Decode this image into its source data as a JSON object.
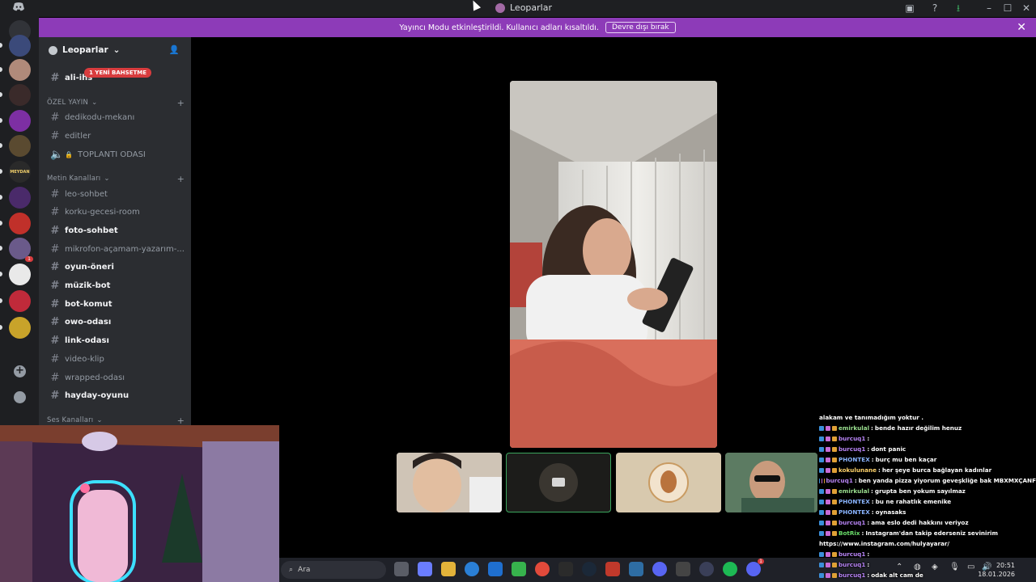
{
  "window": {
    "title": "Leoparlar"
  },
  "banner": {
    "message": "Yayıncı Modu etkinleştirildi. Kullanıcı adları kısaltıldı.",
    "button_label": "Devre dışı bırak"
  },
  "server": {
    "name": "Leoparlar"
  },
  "sidebar": {
    "top_channel": {
      "label": "ali-ihs",
      "mention_badge": "1 YENİ BAHSETME"
    },
    "cat_private": "ÖZEL YAYIN",
    "private_channels": [
      {
        "label": "dedikodu-mekanı"
      },
      {
        "label": "editler"
      },
      {
        "label": "TOPLANTI ODASI"
      }
    ],
    "cat_text": "Metin Kanalları",
    "text_channels": [
      {
        "label": "leo-sohbet"
      },
      {
        "label": "korku-gecesi-room"
      },
      {
        "label": "foto-sohbet"
      },
      {
        "label": "mikrofon-açamam-yazarım-..."
      },
      {
        "label": "oyun-öneri"
      },
      {
        "label": "müzik-bot"
      },
      {
        "label": "bot-komut"
      },
      {
        "label": "owo-odası"
      },
      {
        "label": "link-odası"
      },
      {
        "label": "video-klip"
      },
      {
        "label": "wrapped-odası"
      },
      {
        "label": "hayday-oyunu"
      }
    ],
    "cat_voice": "Ses Kanalları"
  },
  "rail": {
    "servers": [
      {
        "color": "#3b4a7a"
      },
      {
        "color": "#b08a7a"
      },
      {
        "color": "#3a2a2a"
      },
      {
        "color": "#7d2fa3"
      },
      {
        "color": "#5a4a30"
      },
      {
        "color": "#2a2a2a",
        "text": "MEYDAN"
      },
      {
        "color": "#4a2a6a"
      },
      {
        "color": "#c0302a"
      },
      {
        "color": "#6a5a8a",
        "badge": "1"
      },
      {
        "color": "#e9e9e9"
      },
      {
        "color": "#c02a3a"
      },
      {
        "color": "#c8a32a"
      }
    ]
  },
  "taskbar": {
    "search_placeholder": "Ara",
    "time": "20:51",
    "date": "18.01.2026",
    "discord_badge": "1"
  },
  "chat": [
    {
      "user": "",
      "text": "alakam ve tanımadığım yoktur .",
      "color": "#ffffff"
    },
    {
      "user": "emirkulal",
      "text": "bende hazır değilim henuz",
      "color": "#9adf8f"
    },
    {
      "user": "burcuq1",
      "text": "",
      "color": "#b784f5"
    },
    {
      "user": "burcuq1",
      "text": "dont panic",
      "color": "#b784f5"
    },
    {
      "user": "PHONTEX",
      "text": "burç mu ben kaçar",
      "color": "#8ab4ff"
    },
    {
      "user": "kokulunane",
      "text": "her şeye burca bağlayan kadınlar",
      "color": "#ffd36b"
    },
    {
      "user": "burcuq1",
      "text": "ben yanda pizza yiyorum geveşkliğe bak MBXMXÇANF",
      "color": "#b784f5"
    },
    {
      "user": "emirkulal",
      "text": "grupta ben yokum sayılmaz",
      "color": "#9adf8f"
    },
    {
      "user": "PHONTEX",
      "text": "bu ne rahatlık emenike",
      "color": "#8ab4ff"
    },
    {
      "user": "PHONTEX",
      "text": "oynasaks",
      "color": "#8ab4ff"
    },
    {
      "user": "burcuq1",
      "text": "ama eslo dedi hakkını veriyoz",
      "color": "#b784f5"
    },
    {
      "user": "BotRix",
      "text": "Instagram'dan takip ederseniz sevinirim",
      "color": "#6be06b"
    },
    {
      "user": "",
      "text": "https://www.instagram.com/hulyayarar/",
      "color": "#ffffff"
    },
    {
      "user": "burcuq1",
      "text": "",
      "color": "#b784f5"
    },
    {
      "user": "burcuq1",
      "text": "",
      "color": "#b784f5"
    },
    {
      "user": "burcuq1",
      "text": "odak alt cam de",
      "color": "#b784f5"
    }
  ]
}
